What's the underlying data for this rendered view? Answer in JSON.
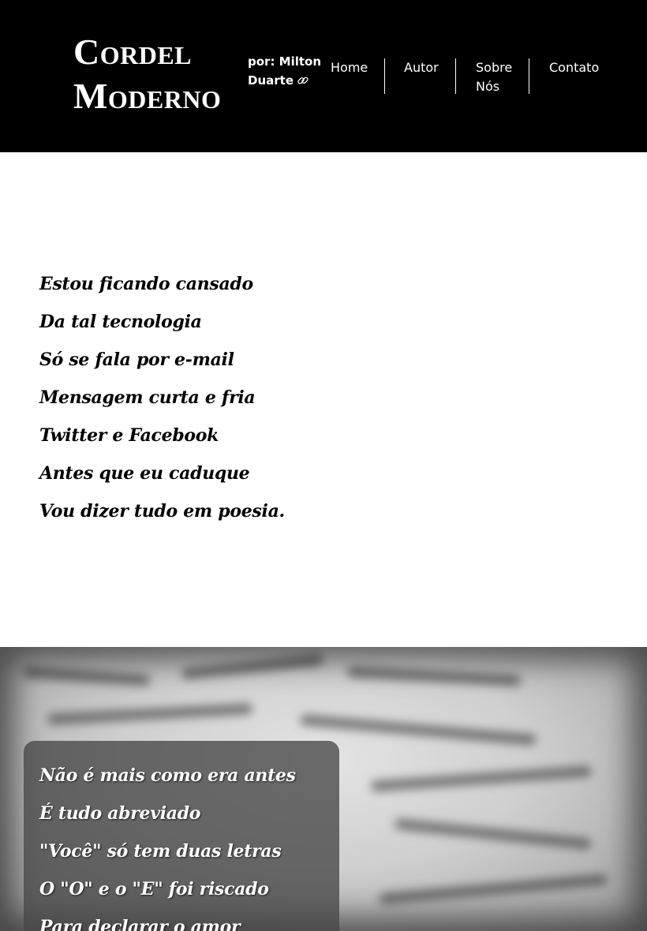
{
  "header": {
    "brand_line1": "Cordel",
    "brand_line2": "Moderno",
    "byline": "por: Milton Duarte",
    "link_icon": "link-icon"
  },
  "nav": {
    "items": [
      {
        "label": "Home"
      },
      {
        "label": "Autor"
      },
      {
        "label": "Sobre Nós"
      },
      {
        "label": "Contato"
      }
    ]
  },
  "poem1": {
    "verses": [
      "Estou ficando cansado",
      "Da tal tecnologia",
      "Só se fala por e-mail",
      "Mensagem curta e fria",
      "Twitter e Facebook",
      "Antes que eu caduque",
      "Vou dizer tudo em poesia."
    ]
  },
  "poem2": {
    "verses": [
      "Não é mais como era antes",
      "É tudo abreviado",
      "\"Você\" só tem duas letras",
      "O \"O\" e o \"E\" foi riscado",
      "Para declarar o amor"
    ]
  },
  "colors": {
    "header_bg": "#000000",
    "header_text": "#ffffff",
    "body_bg": "#ffffff",
    "card_bg": "#464646"
  }
}
